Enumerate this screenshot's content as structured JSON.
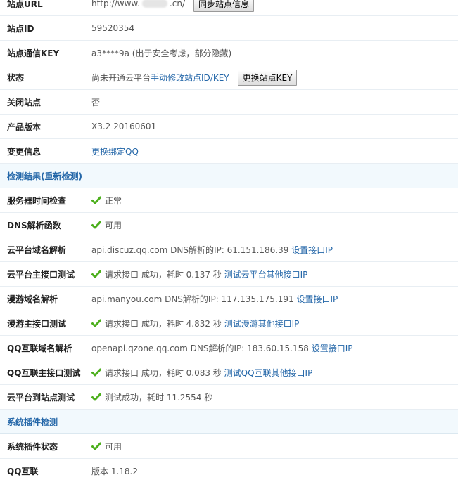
{
  "rows": {
    "site_url": {
      "label": "站点URL",
      "prefix": "http://www.",
      "suffix": ".cn/",
      "button": "同步站点信息"
    },
    "site_id": {
      "label": "站点ID",
      "value": "59520354"
    },
    "site_key": {
      "label": "站点通信KEY",
      "value": "a3****9a (出于安全考虑，部分隐藏)"
    },
    "status": {
      "label": "状态",
      "text": "尚未开通云平台",
      "link": "手动修改站点ID/KEY",
      "button": "更换站点KEY"
    },
    "close_site": {
      "label": "关闭站点",
      "value": "否"
    },
    "version": {
      "label": "产品版本",
      "value": "X3.2 20160601"
    },
    "change_info": {
      "label": "变更信息",
      "link": "更换绑定QQ"
    }
  },
  "detect_section": {
    "title": "检测结果(重新检测)"
  },
  "detect": {
    "server_time": {
      "label": "服务器时间检查",
      "value": "正常"
    },
    "dns_func": {
      "label": "DNS解析函数",
      "value": "可用"
    },
    "cloud_domain": {
      "label": "云平台域名解析",
      "text": "api.discuz.qq.com DNS解析的IP: 61.151.186.39",
      "link": "设置接口IP"
    },
    "cloud_api": {
      "label": "云平台主接口测试",
      "text": "请求接口 成功，耗时 0.137 秒",
      "link": "测试云平台其他接口IP"
    },
    "manyou_domain": {
      "label": "漫游域名解析",
      "text": "api.manyou.com DNS解析的IP: 117.135.175.191",
      "link": "设置接口IP"
    },
    "manyou_api": {
      "label": "漫游主接口测试",
      "text": "请求接口 成功，耗时 4.832 秒",
      "link": "测试漫游其他接口IP"
    },
    "qq_domain": {
      "label": "QQ互联域名解析",
      "text": "openapi.qzone.qq.com DNS解析的IP: 183.60.15.158",
      "link": "设置接口IP"
    },
    "qq_api": {
      "label": "QQ互联主接口测试",
      "text": "请求接口 成功，耗时 0.083 秒",
      "link": "测试QQ互联其他接口IP"
    },
    "cloud_to_site": {
      "label": "云平台到站点测试",
      "text": "测试成功，耗时 11.2554 秒"
    }
  },
  "plugin_section": {
    "title": "系统插件检测"
  },
  "plugins": {
    "plugin_status": {
      "label": "系统插件状态",
      "value": "可用"
    },
    "qq_connect": {
      "label": "QQ互联",
      "value": "版本 1.18.2"
    }
  },
  "colors": {
    "link": "#2366a8",
    "check": "#4caf1c",
    "section_bg": "#f2f9fd"
  }
}
